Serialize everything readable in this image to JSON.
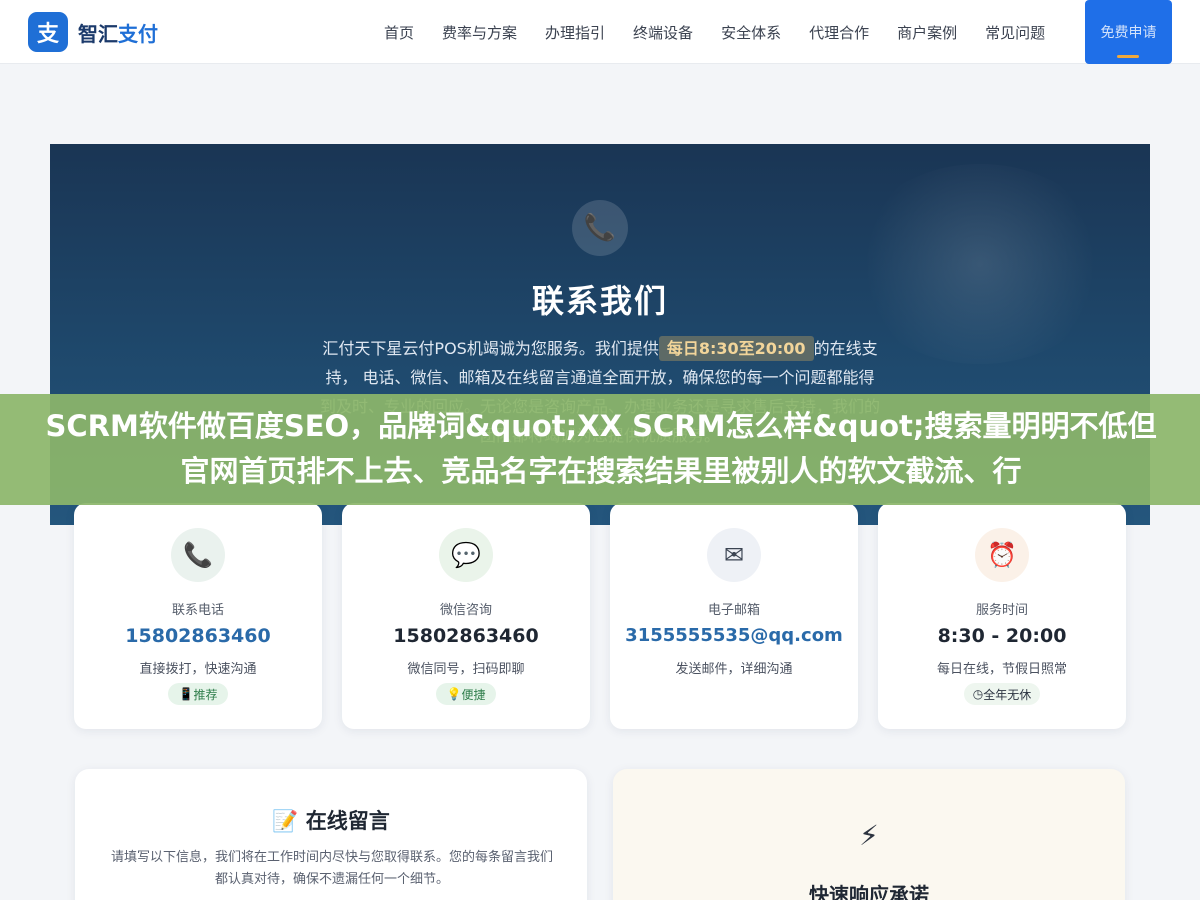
{
  "header": {
    "logo_mark": "支",
    "logo_name_part1": "智汇",
    "logo_name_part2": "支付",
    "nav": [
      "首页",
      "费率与方案",
      "办理指引",
      "终端设备",
      "安全体系",
      "代理合作",
      "商户案例",
      "常见问题"
    ],
    "cta_label": "免费申请"
  },
  "hero": {
    "icon": "phone-icon",
    "title": "联系我们",
    "desc_before": "汇付天下星云付POS机竭诚为您服务。我们提供",
    "desc_highlight": "每日8:30至20:00",
    "desc_after": "的在线支持， 电话、微信、邮箱及在线留言通道全面开放，确保您的每一个问题都能得到及时、专业的回应。无论您是咨询产品、办理业务还是寻求售后支持，我们的团队都将竭诚为您提供优质服务。"
  },
  "overlay": {
    "text": "SCRM软件做百度SEO，品牌词&quot;XX SCRM怎么样&quot;搜索量明明不低但官网首页排不上去、竞品名字在搜索结果里被别人的软文截流、行"
  },
  "cards": [
    {
      "icon": "phone-icon",
      "label": "联系电话",
      "value": "15802863460",
      "sub": "直接拨打，快速沟通",
      "tag_icon": "mobile-icon",
      "tag": "推荐",
      "icon_bg": "#eaf2ee",
      "tag_bg": "#e6f4ea",
      "tag_color": "#2e7d4a"
    },
    {
      "icon": "chat-icon",
      "label": "微信咨询",
      "value": "15802863460",
      "sub": "微信同号，扫码即聊",
      "tag_icon": "bulb-icon",
      "tag": "便捷",
      "icon_bg": "#eaf4ea",
      "tag_bg": "#e6f4ea",
      "tag_color": "#2e7d4a"
    },
    {
      "icon": "mail-icon",
      "label": "电子邮箱",
      "value": "3155555535@qq.com",
      "sub": "发送邮件，详细沟通",
      "tag_icon": "",
      "tag": "",
      "icon_bg": "#eef1f6",
      "tag_bg": "",
      "tag_color": ""
    },
    {
      "icon": "alarm-clock-icon",
      "label": "服务时间",
      "value": "8:30 - 20:00",
      "sub": "每日在线，节假日照常",
      "tag_icon": "clock-icon",
      "tag": "全年无休",
      "icon_bg": "#fbf1e8",
      "tag_bg": "#eef6ef",
      "tag_color": "#2b3340"
    }
  ],
  "message_panel": {
    "icon": "memo-icon",
    "title": "在线留言",
    "desc": "请填写以下信息，我们将在工作时间内尽快与您取得联系。您的每条留言我们都认真对待，确保不遗漏任何一个细节。"
  },
  "promise_panel": {
    "icon": "bolt-icon",
    "title": "快速响应承诺"
  }
}
